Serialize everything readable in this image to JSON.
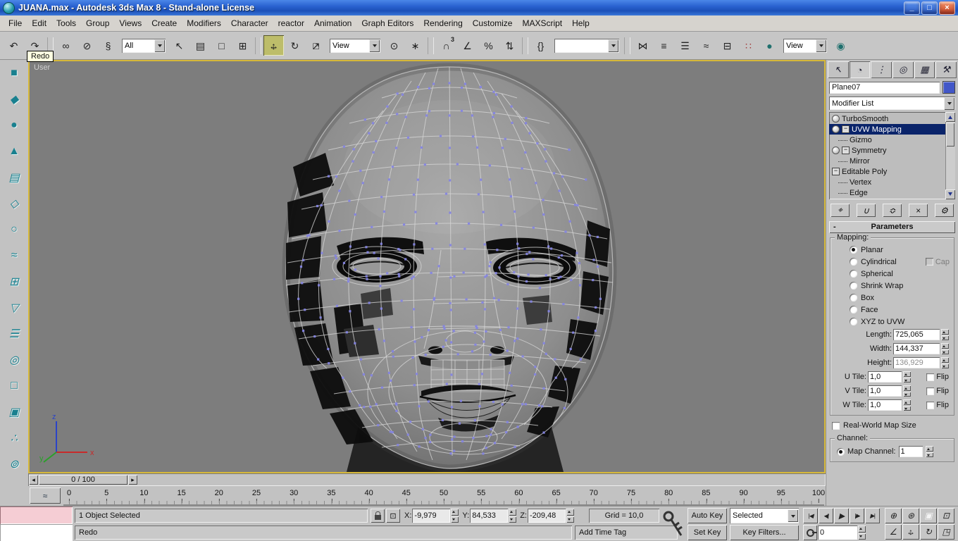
{
  "window": {
    "title": "JUANA.max - Autodesk 3ds Max 8  - Stand-alone License",
    "controls": {
      "minimize": "_",
      "maximize": "□",
      "close": "×"
    }
  },
  "menu": {
    "items": [
      "File",
      "Edit",
      "Tools",
      "Group",
      "Views",
      "Create",
      "Modifiers",
      "Character",
      "reactor",
      "Animation",
      "Graph Editors",
      "Rendering",
      "Customize",
      "MAXScript",
      "Help"
    ]
  },
  "toolbar": {
    "tooltip": "Redo",
    "items": [
      {
        "t": "icon",
        "name": "undo-button",
        "glyph": "↶"
      },
      {
        "t": "icon",
        "name": "redo-button",
        "glyph": "↷"
      },
      {
        "t": "sep"
      },
      {
        "t": "icon",
        "name": "select-and-link-button",
        "glyph": "∞"
      },
      {
        "t": "icon",
        "name": "unlink-selection-button",
        "glyph": "⊘"
      },
      {
        "t": "icon",
        "name": "bind-to-space-warp-button",
        "glyph": "§"
      },
      {
        "t": "dd",
        "name": "selection-filter-dropdown",
        "value": "All",
        "w": 62
      },
      {
        "t": "icon",
        "name": "select-object-button",
        "glyph": "↖"
      },
      {
        "t": "icon",
        "name": "select-by-name-button",
        "glyph": "▤"
      },
      {
        "t": "icon",
        "name": "rectangular-selection-region-button",
        "glyph": "□"
      },
      {
        "t": "icon",
        "name": "window-crossing-toggle-button",
        "glyph": "⊞"
      },
      {
        "t": "sep"
      },
      {
        "t": "icon",
        "name": "select-and-move-button",
        "glyph": "↔",
        "glyph2": "↕",
        "active": true
      },
      {
        "t": "icon",
        "name": "select-and-rotate-button",
        "glyph": "↻"
      },
      {
        "t": "icon",
        "name": "select-and-uniform-scale-button",
        "glyph": "□",
        "glyph2": "↗"
      },
      {
        "t": "dd",
        "name": "reference-coordinate-system-dropdown",
        "value": "View",
        "w": 72
      },
      {
        "t": "icon",
        "name": "use-pivot-point-center-button",
        "glyph": "⊙"
      },
      {
        "t": "icon",
        "name": "select-and-manipulate-button",
        "glyph": "∗"
      },
      {
        "t": "sep"
      },
      {
        "t": "icon",
        "name": "snaps-toggle-3d-button",
        "glyph": "∩",
        "sup": "3"
      },
      {
        "t": "icon",
        "name": "angle-snap-toggle-button",
        "glyph": "∠"
      },
      {
        "t": "icon",
        "name": "percent-snap-toggle-button",
        "glyph": "%"
      },
      {
        "t": "icon",
        "name": "spinner-snap-toggle-button",
        "glyph": "⇅"
      },
      {
        "t": "sep"
      },
      {
        "t": "icon",
        "name": "edit-named-selection-sets-button",
        "glyph": "{}"
      },
      {
        "t": "dd",
        "name": "named-selection-sets-dropdown",
        "value": "",
        "w": 92
      },
      {
        "t": "sep"
      },
      {
        "t": "icon",
        "name": "mirror-button",
        "glyph": "⋈"
      },
      {
        "t": "icon",
        "name": "align-button",
        "glyph": "≡"
      },
      {
        "t": "icon",
        "name": "layer-manager-button",
        "glyph": "☰"
      },
      {
        "t": "icon",
        "name": "curve-editor-button",
        "glyph": "≈"
      },
      {
        "t": "icon",
        "name": "schematic-view-button",
        "glyph": "⊟"
      },
      {
        "t": "icon",
        "name": "material-editor-button",
        "glyph": "∷",
        "color": "#a03636"
      },
      {
        "t": "icon",
        "name": "render-scene-button",
        "glyph": "●",
        "color": "#20706e"
      },
      {
        "t": "dd",
        "name": "render-type-dropdown",
        "value": "View",
        "w": 62
      },
      {
        "t": "icon",
        "name": "quick-render-button",
        "glyph": "◉",
        "color": "#20706e"
      }
    ]
  },
  "reactor": {
    "items": [
      {
        "name": "reactor-tool-1-button",
        "glyph": "■"
      },
      {
        "name": "reactor-tool-2-button",
        "glyph": "◆"
      },
      {
        "name": "reactor-tool-3-button",
        "glyph": "●"
      },
      {
        "name": "reactor-tool-4-button",
        "glyph": "▲"
      },
      {
        "name": "reactor-tool-5-button",
        "glyph": "▤"
      },
      {
        "name": "reactor-tool-6-button",
        "glyph": "◇"
      },
      {
        "name": "reactor-tool-7-button",
        "glyph": "○"
      },
      {
        "name": "reactor-tool-8-button",
        "glyph": "≈"
      },
      {
        "name": "reactor-tool-9-button",
        "glyph": "⊞"
      },
      {
        "name": "reactor-tool-10-button",
        "glyph": "▽"
      },
      {
        "name": "reactor-tool-11-button",
        "glyph": "☰"
      },
      {
        "name": "reactor-tool-12-button",
        "glyph": "◎"
      },
      {
        "name": "reactor-tool-13-button",
        "glyph": "□"
      },
      {
        "name": "reactor-tool-14-button",
        "glyph": "▣"
      },
      {
        "name": "reactor-tool-15-button",
        "glyph": "∴"
      },
      {
        "name": "reactor-tool-16-button",
        "glyph": "⊚"
      }
    ]
  },
  "viewport": {
    "label": "User",
    "axis_labels": {
      "x": "x",
      "y": "y",
      "z": "z"
    }
  },
  "command_panel": {
    "tabs": [
      {
        "name": "tab-create",
        "glyph": "↖"
      },
      {
        "name": "tab-modify",
        "glyph": "◔",
        "active": true
      },
      {
        "name": "tab-hierarchy",
        "glyph": "⋮"
      },
      {
        "name": "tab-motion",
        "glyph": "◎"
      },
      {
        "name": "tab-display",
        "glyph": "▦"
      },
      {
        "name": "tab-utilities",
        "glyph": "⚒"
      }
    ],
    "object_name": "Plane07",
    "modifier_list_label": "Modifier List",
    "stack_items": [
      {
        "label": "TurboSmooth",
        "kind": "modifier",
        "bulb": true
      },
      {
        "label": "UVW Mapping",
        "kind": "modifier",
        "bulb": true,
        "expand": true,
        "selected": true
      },
      {
        "label": "Gizmo",
        "kind": "sub"
      },
      {
        "label": "Symmetry",
        "kind": "modifier",
        "bulb": true,
        "expand": true
      },
      {
        "label": "Mirror",
        "kind": "sub"
      },
      {
        "label": "Editable Poly",
        "kind": "base",
        "expand": true
      },
      {
        "label": "Vertex",
        "kind": "sub"
      },
      {
        "label": "Edge",
        "kind": "sub"
      }
    ],
    "stack_buttons": [
      {
        "name": "pin-stack-button",
        "glyph": "⌖"
      },
      {
        "name": "show-end-result-button",
        "glyph": "∪"
      },
      {
        "name": "make-unique-button",
        "glyph": "≎"
      },
      {
        "name": "remove-modifier-button",
        "glyph": "×"
      },
      {
        "name": "configure-modifier-sets-button",
        "glyph": "⚙"
      }
    ],
    "parameters": {
      "title": "Parameters",
      "mapping": {
        "group_label": "Mapping:",
        "options": [
          {
            "label": "Planar",
            "selected": true
          },
          {
            "label": "Cylindrical",
            "selected": false,
            "extra": "Cap"
          },
          {
            "label": "Spherical",
            "selected": false
          },
          {
            "label": "Shrink Wrap",
            "selected": false
          },
          {
            "label": "Box",
            "selected": false
          },
          {
            "label": "Face",
            "selected": false
          },
          {
            "label": "XYZ to UVW",
            "selected": false
          }
        ],
        "fields": [
          {
            "label": "Length:",
            "value": "725,065",
            "enabled": true
          },
          {
            "label": "Width:",
            "value": "144,337",
            "enabled": true
          },
          {
            "label": "Height:",
            "value": "136,929",
            "enabled": false
          }
        ],
        "tiles": [
          {
            "label": "U Tile:",
            "value": "1,0",
            "flip": "Flip"
          },
          {
            "label": "V Tile:",
            "value": "1,0",
            "flip": "Flip"
          },
          {
            "label": "W Tile:",
            "value": "1,0",
            "flip": "Flip"
          }
        ],
        "real_world": "Real-World Map Size"
      },
      "channel": {
        "group_label": "Channel:",
        "map_channel_label": "Map Channel:",
        "map_channel_value": "1"
      }
    }
  },
  "timeline": {
    "slider_label": "0 / 100",
    "ticks": [
      "0",
      "5",
      "10",
      "15",
      "20",
      "25",
      "30",
      "35",
      "40",
      "45",
      "50",
      "55",
      "60",
      "65",
      "70",
      "75",
      "80",
      "85",
      "90",
      "95",
      "100"
    ]
  },
  "status": {
    "selection_text": "1 Object Selected",
    "coords": [
      {
        "label": "X:",
        "value": "-9,979"
      },
      {
        "label": "Y:",
        "value": "84,533"
      },
      {
        "label": "Z:",
        "value": "-209,48"
      }
    ],
    "grid": "Grid = 10,0",
    "prompt": "Redo",
    "time_tag": "Add Time Tag"
  },
  "animation": {
    "auto_key": "Auto Key",
    "set_key": "Set Key",
    "key_mode": "Selected",
    "key_filters": "Key Filters...",
    "frame": "0",
    "playback": [
      {
        "name": "go-to-start-button",
        "glyph": "|◀"
      },
      {
        "name": "previous-frame-button",
        "glyph": "◀|"
      },
      {
        "name": "play-button",
        "glyph": "▶",
        "play": true
      },
      {
        "name": "next-frame-button",
        "glyph": "|▶"
      },
      {
        "name": "go-to-end-button",
        "glyph": "▶|"
      }
    ]
  },
  "nav": {
    "items": [
      {
        "name": "zoom-button",
        "glyph": "⊕"
      },
      {
        "name": "zoom-all-button",
        "glyph": "⊛"
      },
      {
        "name": "zoom-extents-button",
        "glyph": "▣",
        "color": "#f4f4f4"
      },
      {
        "name": "zoom-region-button",
        "glyph": "⊡"
      },
      {
        "name": "field-of-view-button",
        "glyph": "∠"
      },
      {
        "name": "pan-button",
        "glyph": "↔",
        "glyph2": "↕"
      },
      {
        "name": "arc-rotate-button",
        "glyph": "↻"
      },
      {
        "name": "min-max-toggle-button",
        "glyph": "◳"
      }
    ]
  }
}
